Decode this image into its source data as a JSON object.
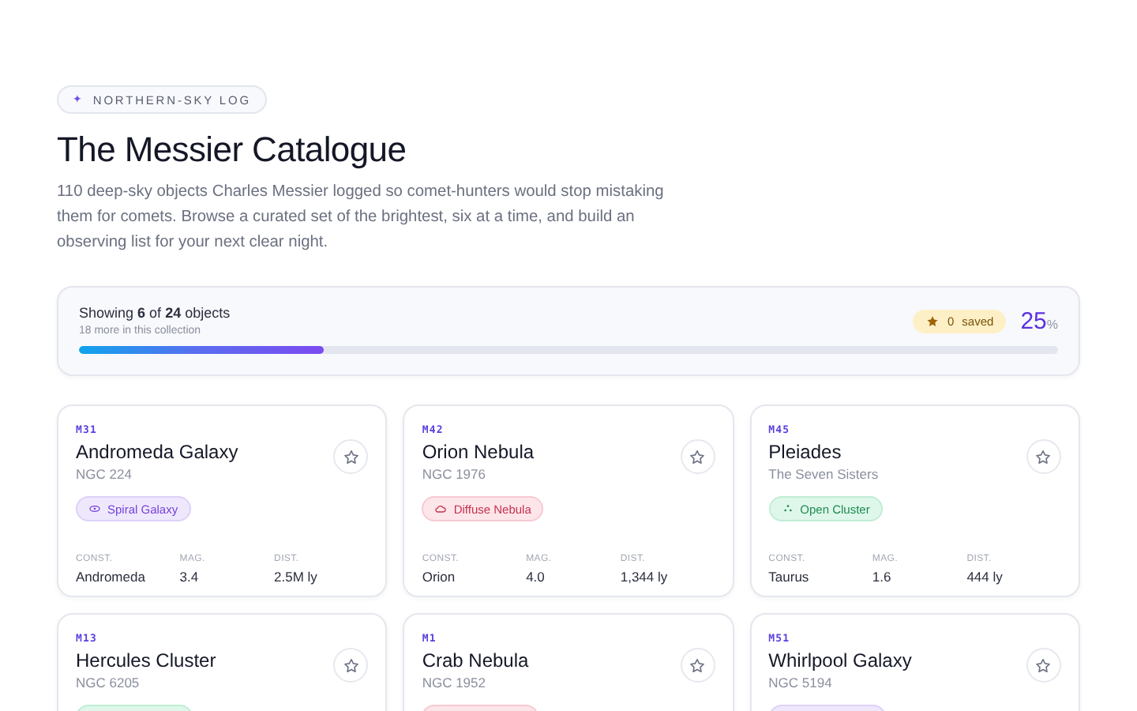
{
  "eyebrow": {
    "icon": "✦",
    "label": "NORTHERN-SKY LOG"
  },
  "title": "The Messier Catalogue",
  "intro": "110 deep-sky objects Charles Messier logged so comet-hunters would stop mistaking them for comets. Browse a curated set of the brightest, six at a time, and build an observing list for your next clear night.",
  "progress": {
    "showing": "Showing **6** of **24** objects",
    "remaining": "18 more in this collection",
    "saved_count": "0",
    "saved_label": "saved",
    "percent": "25",
    "percent_unit": "%",
    "level": 0.25
  },
  "objects": [
    {
      "code": "M31",
      "name": "Andromeda Galaxy",
      "alias": "NGC 224",
      "tag": {
        "kind": "galaxy",
        "label": "Spiral Galaxy"
      },
      "saved": false,
      "stats": [
        {
          "label": "CONST.",
          "value": "Andromeda"
        },
        {
          "label": "MAG.",
          "value": "3.4"
        },
        {
          "label": "DIST.",
          "value": "2.5M ly"
        }
      ]
    },
    {
      "code": "M42",
      "name": "Orion Nebula",
      "alias": "NGC 1976",
      "tag": {
        "kind": "nebula",
        "label": "Diffuse Nebula"
      },
      "saved": false,
      "stats": [
        {
          "label": "CONST.",
          "value": "Orion"
        },
        {
          "label": "MAG.",
          "value": "4.0"
        },
        {
          "label": "DIST.",
          "value": "1,344 ly"
        }
      ]
    },
    {
      "code": "M45",
      "name": "Pleiades",
      "alias": "The Seven Sisters",
      "tag": {
        "kind": "cluster",
        "label": "Open Cluster"
      },
      "saved": false,
      "stats": [
        {
          "label": "CONST.",
          "value": "Taurus"
        },
        {
          "label": "MAG.",
          "value": "1.6"
        },
        {
          "label": "DIST.",
          "value": "444 ly"
        }
      ]
    },
    {
      "code": "M13",
      "name": "Hercules Cluster",
      "alias": "NGC 6205",
      "tag": {
        "kind": "cluster"
      },
      "saved": false
    },
    {
      "code": "M1",
      "name": "Crab Nebula",
      "alias": "NGC 1952",
      "tag": {
        "kind": "nebula"
      },
      "saved": false
    },
    {
      "code": "M51",
      "name": "Whirlpool Galaxy",
      "alias": "NGC 5194",
      "tag": {
        "kind": "galaxy"
      },
      "saved": false
    }
  ]
}
